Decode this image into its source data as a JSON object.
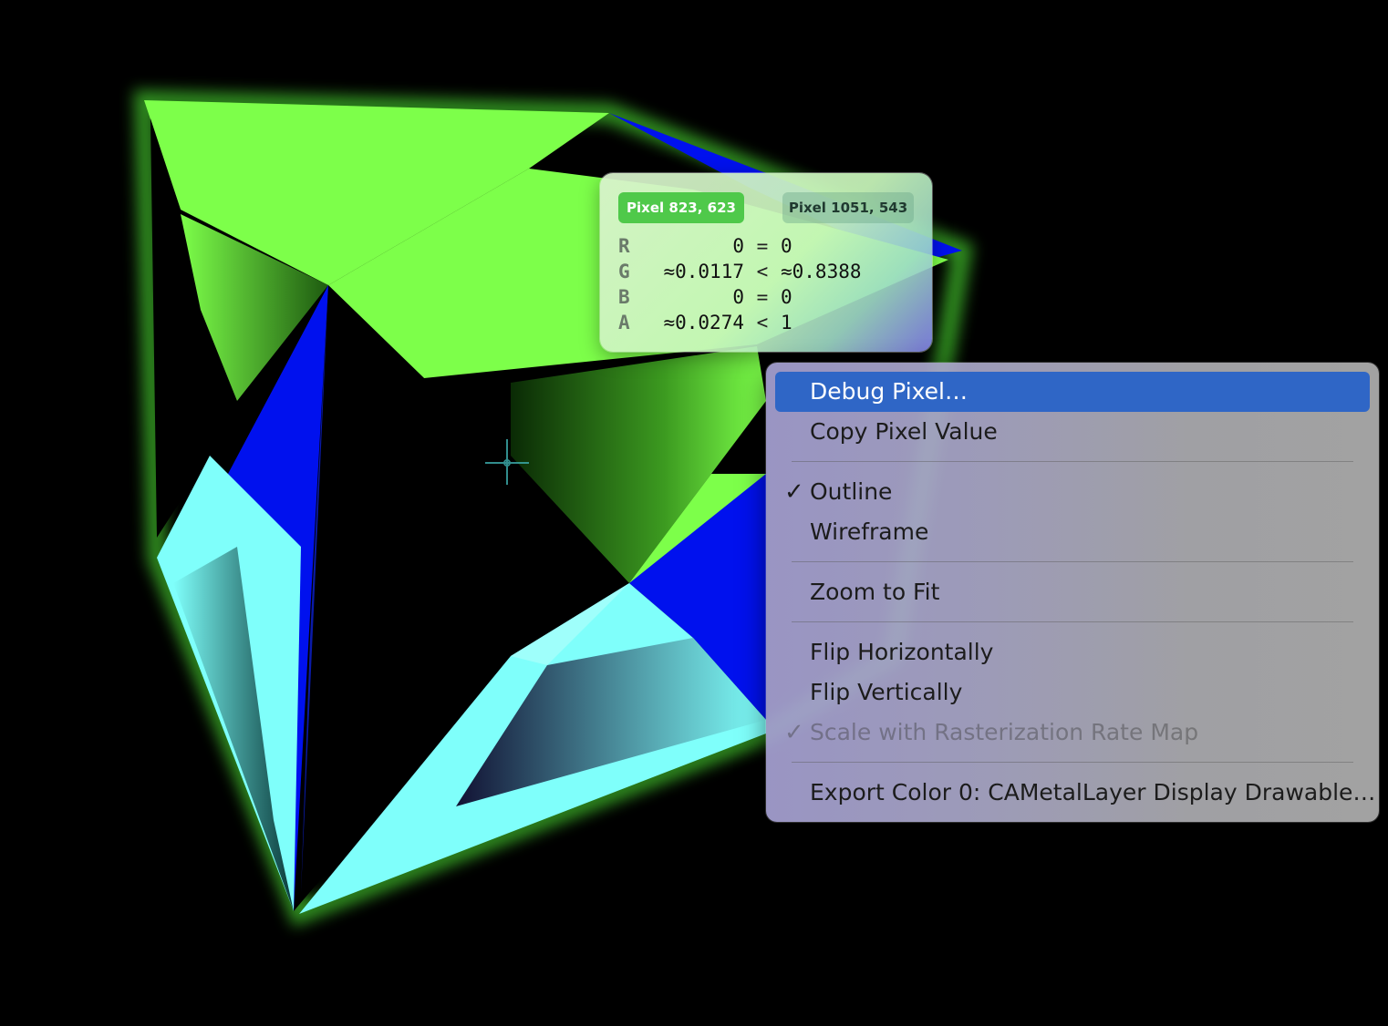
{
  "inspector": {
    "pixel_a": "Pixel 823, 623",
    "pixel_b": "Pixel 1051, 543",
    "rows": [
      {
        "channel": "R",
        "a": "0",
        "op": "=",
        "b": "0"
      },
      {
        "channel": "G",
        "a": "≈0.0117",
        "op": "<",
        "b": "≈0.8388"
      },
      {
        "channel": "B",
        "a": "0",
        "op": "=",
        "b": "0"
      },
      {
        "channel": "A",
        "a": "≈0.0274",
        "op": "<",
        "b": "1"
      }
    ]
  },
  "context_menu": {
    "debug_pixel": "Debug Pixel…",
    "copy_pixel_value": "Copy Pixel Value",
    "outline": "Outline",
    "outline_checked": "✓",
    "wireframe": "Wireframe",
    "zoom_to_fit": "Zoom to Fit",
    "flip_horizontally": "Flip Horizontally",
    "flip_vertically": "Flip Vertically",
    "scale_with_rrm": "Scale with Rasterization Rate Map",
    "scale_checked": "✓",
    "export_color": "Export Color 0: CAMetalLayer Display Drawable…"
  },
  "colors": {
    "green": "#7dff4a",
    "cyan": "#7ffffb",
    "blue": "#0011ee",
    "highlight": "#2f66c6"
  },
  "icons": {
    "cursor": "crosshair-icon",
    "check": "checkmark-icon"
  }
}
